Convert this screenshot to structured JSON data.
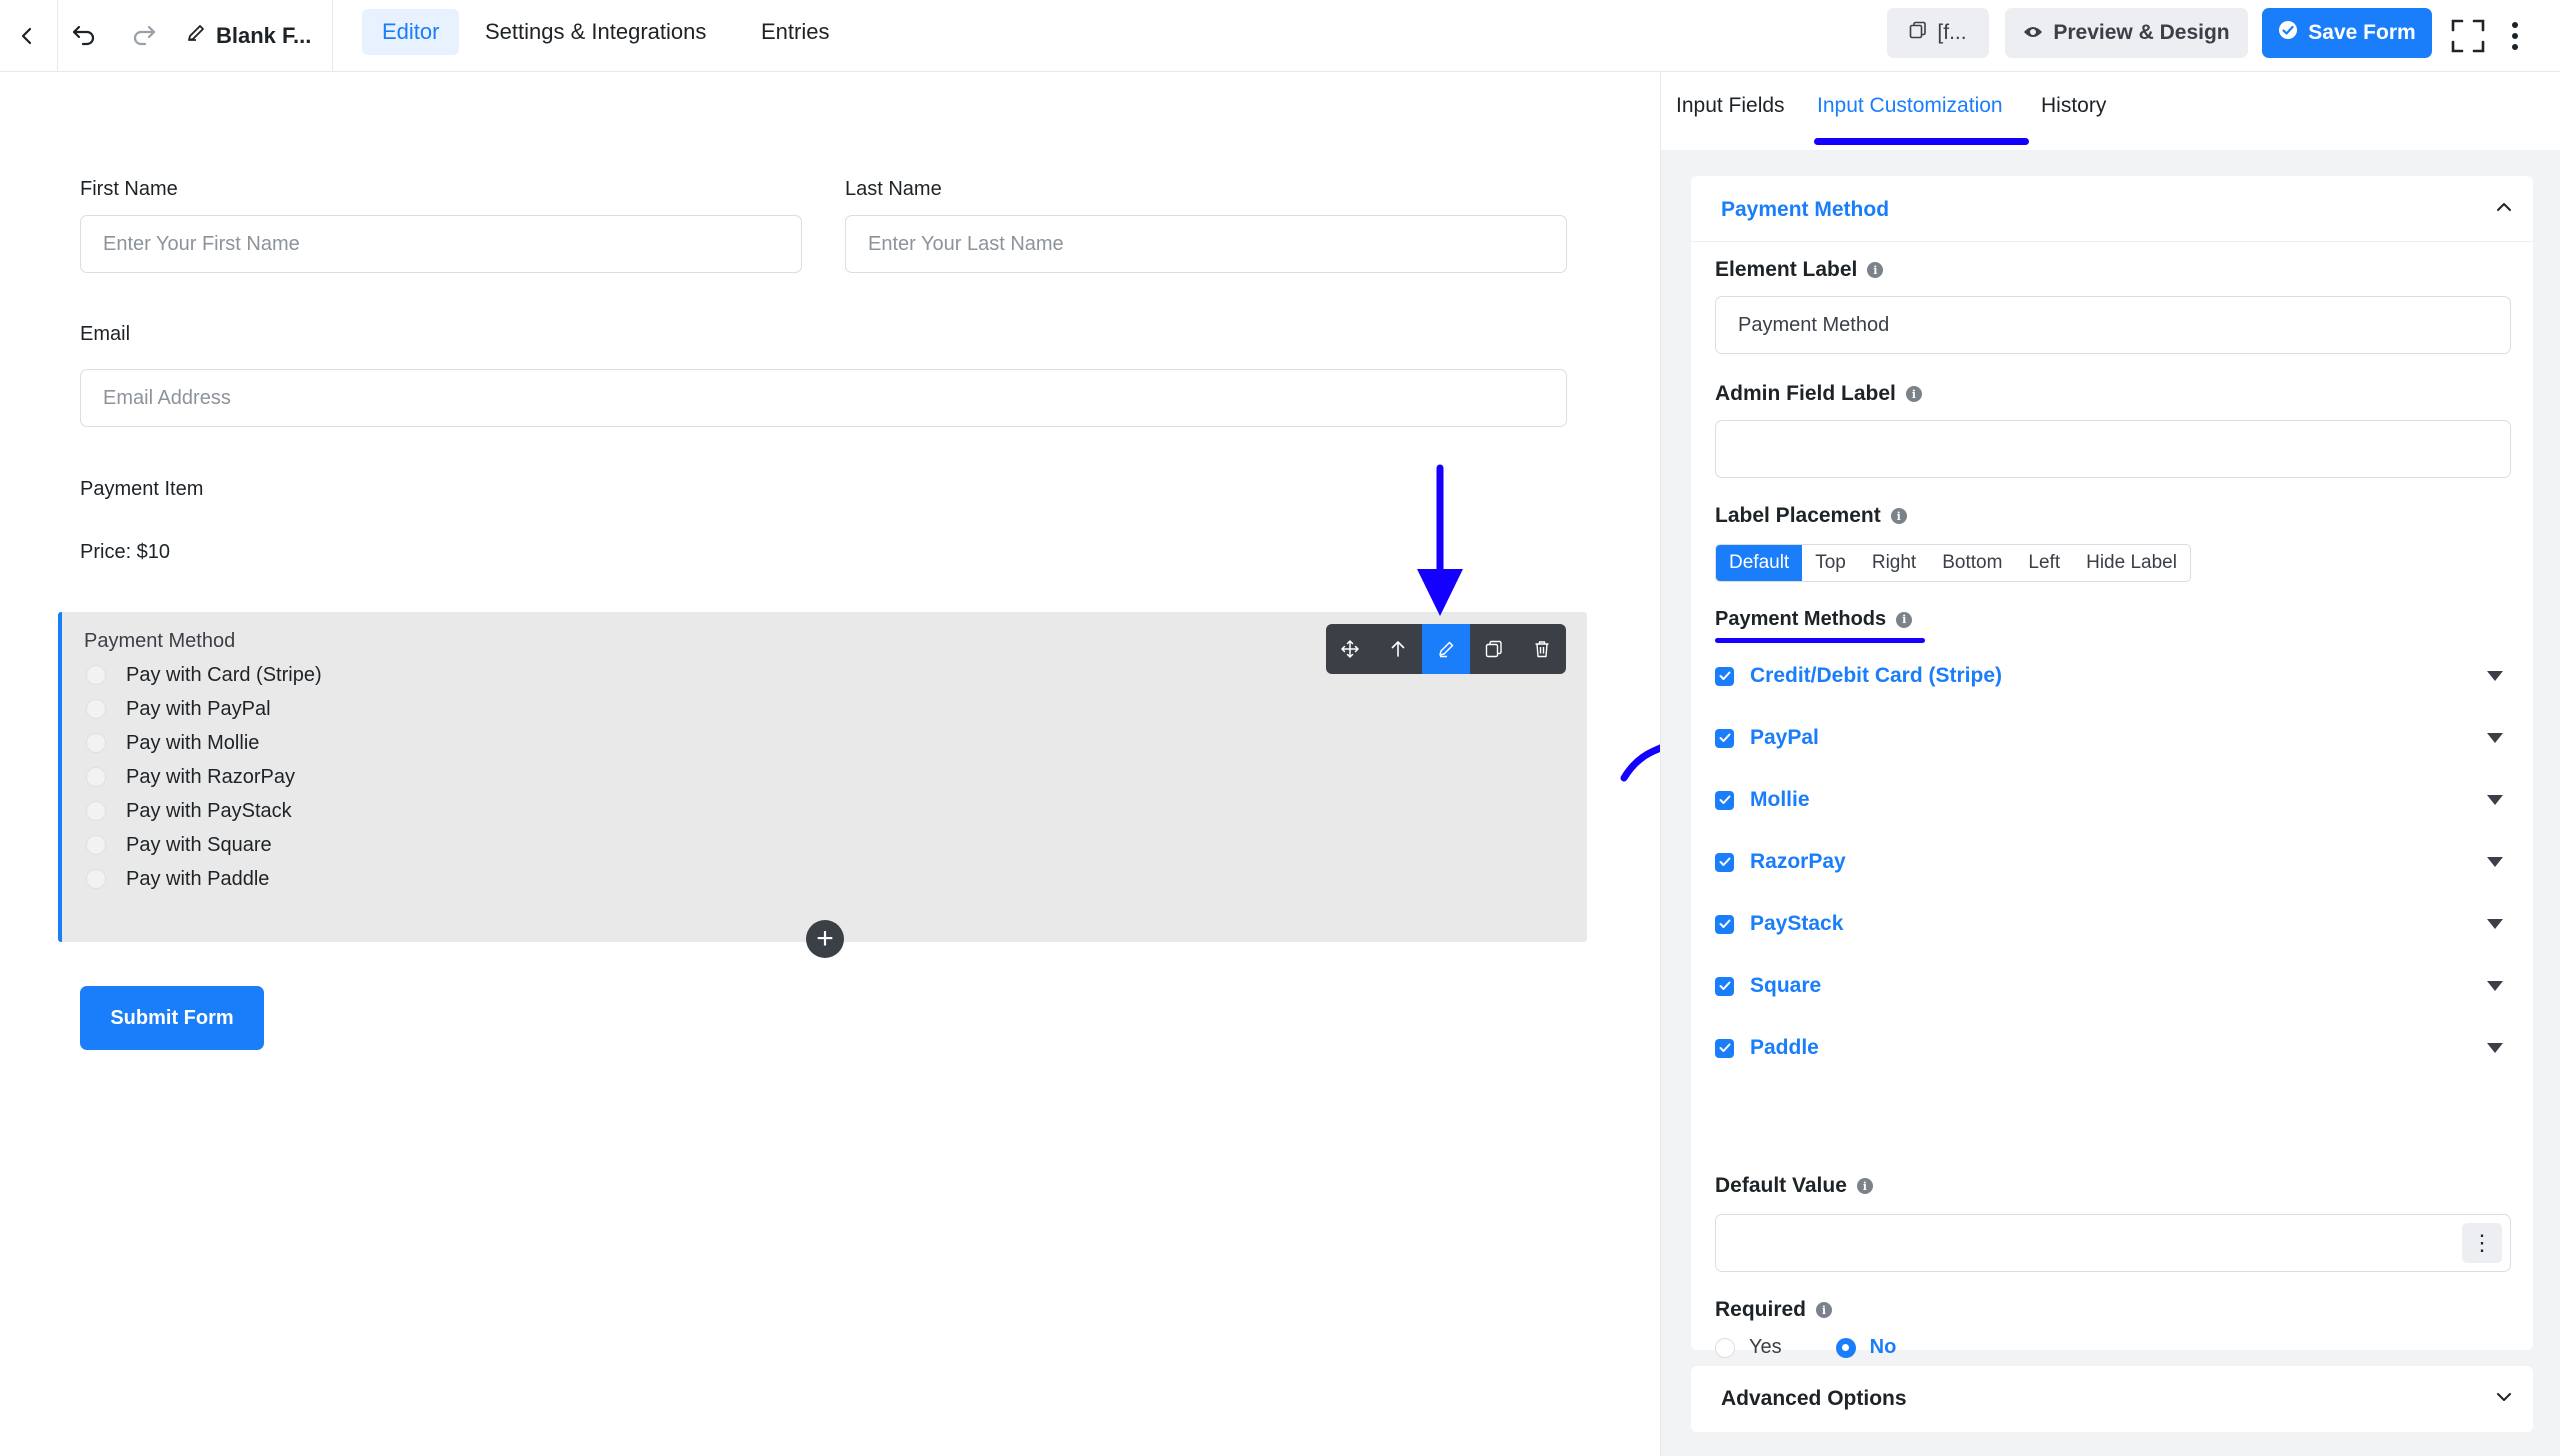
{
  "topbar": {
    "form_title": "Blank F...",
    "nav_tabs": [
      "Editor",
      "Settings & Integrations",
      "Entries"
    ],
    "shortcode_label": "[f...",
    "preview_label": "Preview & Design",
    "save_label": "Save Form"
  },
  "form": {
    "first_name": {
      "label": "First Name",
      "placeholder": "Enter Your First Name"
    },
    "last_name": {
      "label": "Last Name",
      "placeholder": "Enter Your Last Name"
    },
    "email": {
      "label": "Email",
      "placeholder": "Email Address"
    },
    "payment_item": {
      "label": "Payment Item",
      "price": "Price: $10"
    },
    "payment_method": {
      "label": "Payment Method",
      "options": [
        "Pay with Card (Stripe)",
        "Pay with PayPal",
        "Pay with Mollie",
        "Pay with RazorPay",
        "Pay with PayStack",
        "Pay with Square",
        "Pay with Paddle"
      ]
    },
    "submit_label": "Submit Form"
  },
  "panel": {
    "tabs": [
      "Input Fields",
      "Input Customization",
      "History"
    ],
    "section_title": "Payment Method",
    "element_label": {
      "label": "Element Label",
      "value": "Payment Method"
    },
    "admin_field_label": {
      "label": "Admin Field Label",
      "value": ""
    },
    "label_placement": {
      "label": "Label Placement",
      "options": [
        "Default",
        "Top",
        "Right",
        "Bottom",
        "Left",
        "Hide Label"
      ],
      "selected": "Default"
    },
    "payment_methods": {
      "label": "Payment Methods",
      "items": [
        "Credit/Debit Card (Stripe)",
        "PayPal",
        "Mollie",
        "RazorPay",
        "PayStack",
        "Square",
        "Paddle"
      ]
    },
    "default_value": {
      "label": "Default Value",
      "value": ""
    },
    "required": {
      "label": "Required",
      "options": [
        "Yes",
        "No"
      ],
      "selected": "No"
    },
    "advanced_options": "Advanced Options"
  },
  "colors": {
    "accent": "#1a7efb",
    "annotation": "#1400ff"
  }
}
